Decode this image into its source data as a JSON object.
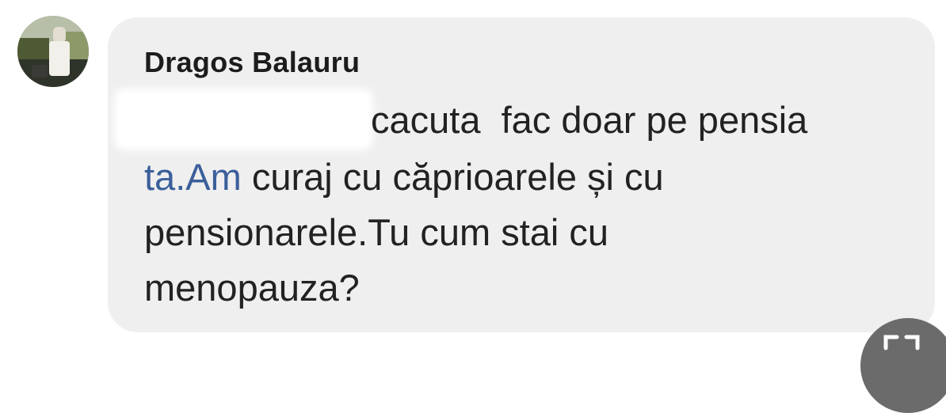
{
  "comment": {
    "author": "Dragos Balauru",
    "text_lines": [
      "cacuta  fac doar pe pensia",
      "curaj cu căprioarele și cu",
      "pensionarele.Tu cum stai cu",
      "menopauza?"
    ],
    "link_text": "ta.Am"
  },
  "icons": {
    "avatar": "avatar",
    "corner": "expand-icon"
  },
  "colors": {
    "bubble_background": "#efefef",
    "link": "#3b5f9a",
    "text": "#222222"
  }
}
